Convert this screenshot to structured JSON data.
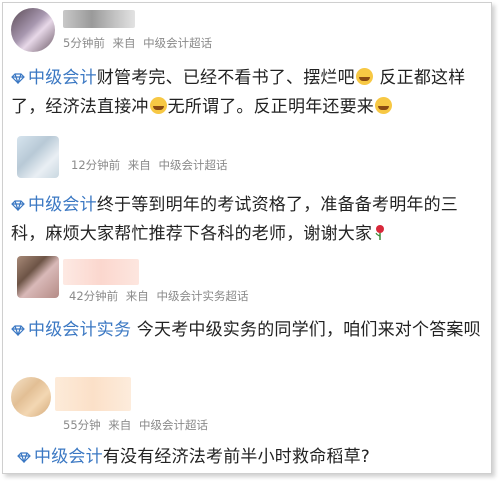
{
  "posts": [
    {
      "meta": {
        "time": "5分钟前",
        "from": "来自",
        "source": "中级会计超话"
      },
      "tag": "中级会计",
      "text1": "财管考完、已经不看书了、摆烂吧",
      "text2": " 反正都这样了，经济法直接冲",
      "text3": "无所谓了。反正明年还要来"
    },
    {
      "meta": {
        "time": "12分钟前",
        "from": "来自",
        "source": "中级会计超话"
      },
      "tag": "中级会计",
      "text": "终于等到明年的考试资格了，准备备考明年的三科，麻烦大家帮忙推荐下各科的老师，谢谢大家"
    },
    {
      "meta": {
        "time": "42分钟前",
        "from": "来自",
        "source": "中级会计实务超话"
      },
      "tag": "中级会计实务",
      "text": " 今天考中级实务的同学们，咱们来对个答案呗"
    },
    {
      "meta": {
        "time": "55分钟",
        "from": "来自",
        "source": "中级会计超话"
      },
      "tag": "中级会计",
      "text": "有没有经济法考前半小时救命稻草?"
    }
  ],
  "icons": {
    "tag": "diamond-icon",
    "emoji": "laughing-emoji-icon",
    "rose": "rose-icon"
  },
  "colors": {
    "tag": "#3b78c3",
    "meta": "#8a8a8a"
  }
}
